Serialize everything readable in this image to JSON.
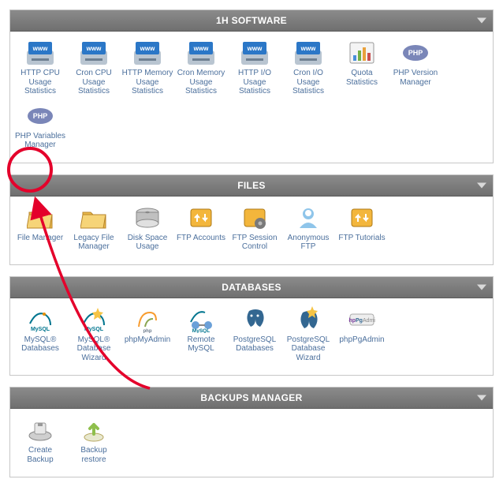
{
  "sections": [
    {
      "title": "1H SOFTWARE",
      "items": [
        {
          "name": "http-cpu-usage-stats",
          "label": "HTTP CPU Usage Statistics",
          "icon": "globe"
        },
        {
          "name": "cron-cpu-usage-stats",
          "label": "Cron CPU Usage Statistics",
          "icon": "globe"
        },
        {
          "name": "http-memory-usage-stats",
          "label": "HTTP Memory Usage Statistics",
          "icon": "globe"
        },
        {
          "name": "cron-memory-usage-stats",
          "label": "Cron Memory Usage Statistics",
          "icon": "globe"
        },
        {
          "name": "http-io-usage-stats",
          "label": "HTTP I/O Usage Statistics",
          "icon": "globe"
        },
        {
          "name": "cron-io-usage-stats",
          "label": "Cron I/O Usage Statistics",
          "icon": "globe"
        },
        {
          "name": "quota-statistics",
          "label": "Quota Statistics",
          "icon": "chart"
        },
        {
          "name": "php-version-manager",
          "label": "PHP Version Manager",
          "icon": "php"
        },
        {
          "name": "php-variables-manager",
          "label": "PHP Variables Manager",
          "icon": "php"
        }
      ]
    },
    {
      "title": "FILES",
      "items": [
        {
          "name": "file-manager",
          "label": "File Manager",
          "icon": "folder"
        },
        {
          "name": "legacy-file-manager",
          "label": "Legacy File Manager",
          "icon": "folder"
        },
        {
          "name": "disk-space-usage",
          "label": "Disk Space Usage",
          "icon": "disk"
        },
        {
          "name": "ftp-accounts",
          "label": "FTP Accounts",
          "icon": "ftp"
        },
        {
          "name": "ftp-session-control",
          "label": "FTP Session Control",
          "icon": "ftp-gear"
        },
        {
          "name": "anonymous-ftp",
          "label": "Anonymous FTP",
          "icon": "ftp-user"
        },
        {
          "name": "ftp-tutorials",
          "label": "FTP Tutorials",
          "icon": "ftp"
        }
      ]
    },
    {
      "title": "DATABASES",
      "items": [
        {
          "name": "mysql-databases",
          "label": "MySQL® Databases",
          "icon": "mysql"
        },
        {
          "name": "mysql-database-wizard",
          "label": "MySQL® Database Wizard",
          "icon": "mysql-wiz"
        },
        {
          "name": "phpmyadmin",
          "label": "phpMyAdmin",
          "icon": "pma"
        },
        {
          "name": "remote-mysql",
          "label": "Remote MySQL",
          "icon": "mysql-remote"
        },
        {
          "name": "postgresql-databases",
          "label": "PostgreSQL Databases",
          "icon": "pg"
        },
        {
          "name": "postgresql-database-wizard",
          "label": "PostgreSQL Database Wizard",
          "icon": "pg-wiz"
        },
        {
          "name": "phppgadmin",
          "label": "phpPgAdmin",
          "icon": "ppga"
        }
      ]
    },
    {
      "title": "BACKUPS MANAGER",
      "items": [
        {
          "name": "create-backup",
          "label": "Create Backup",
          "icon": "backup"
        },
        {
          "name": "backup-restore",
          "label": "Backup restore",
          "icon": "restore"
        }
      ]
    }
  ]
}
